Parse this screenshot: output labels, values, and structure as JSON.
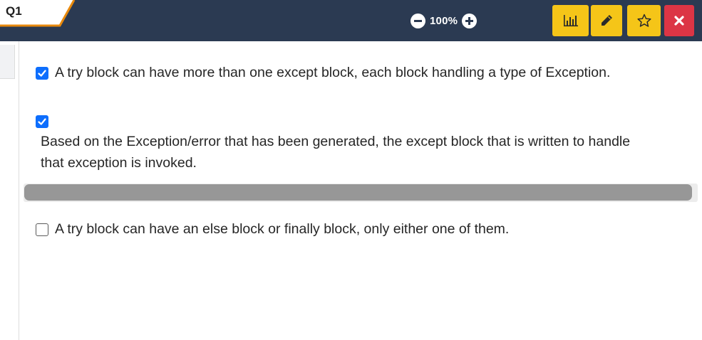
{
  "question": {
    "tab_label": "Q1"
  },
  "zoom": {
    "level": "100%",
    "decrease_icon": "minus-circle-icon",
    "increase_icon": "plus-circle-icon"
  },
  "toolbar": {
    "buttons": [
      {
        "icon": "bar-chart-icon",
        "color": "#f5c518"
      },
      {
        "icon": "pencil-icon",
        "color": "#f5c518"
      },
      {
        "icon": "star-icon",
        "color": "#f5c518"
      },
      {
        "icon": "close-icon",
        "color": "#dc3545"
      }
    ]
  },
  "options": [
    {
      "text": "A try block can have more than one except block, each block handling a type of Exception.",
      "checked": true
    },
    {
      "text_line1": "Based on the Exception/error that has been generated, the except block that is written to handle",
      "text_line2": "that exception is invoked.",
      "checked": true
    },
    {
      "text": "A try block can have an else block or finally block, only either one of them.",
      "checked": false
    }
  ],
  "colors": {
    "header_bg": "#2b3a52",
    "accent": "#e8890c",
    "checkbox": "#0d6efd",
    "close": "#dc3545"
  }
}
